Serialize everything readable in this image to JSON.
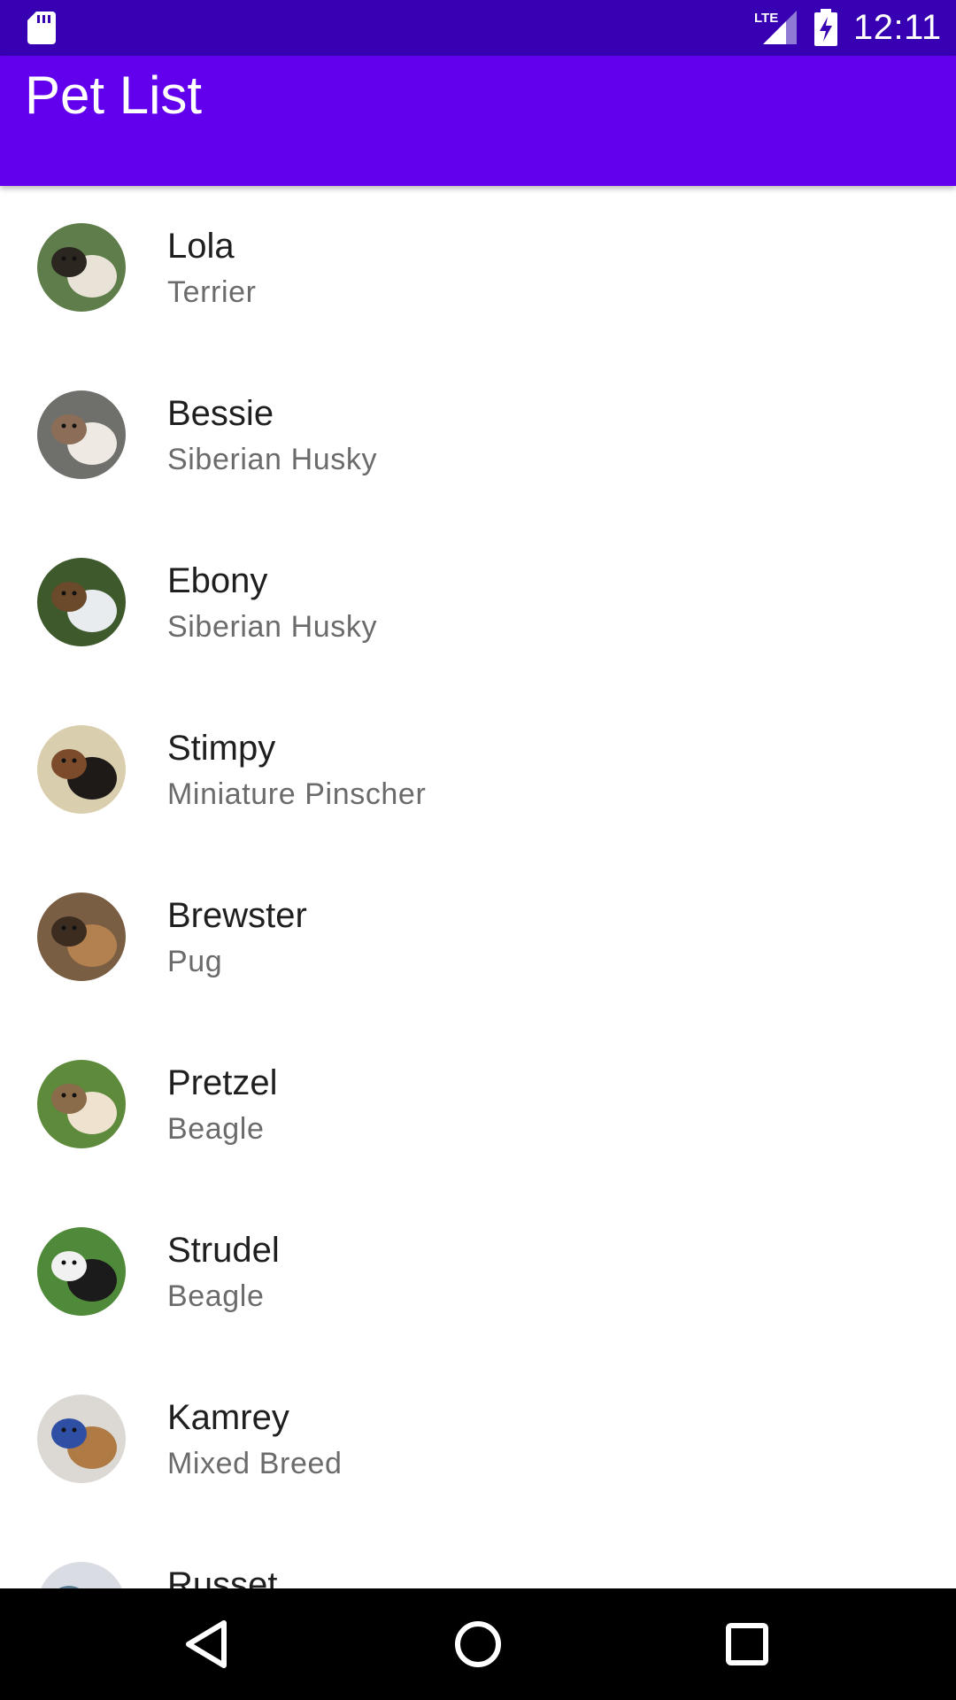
{
  "status_bar": {
    "time": "12:11",
    "network": "LTE",
    "icons": [
      "sd-card-icon",
      "lte-signal-icon",
      "battery-charging-icon"
    ]
  },
  "app_bar": {
    "title": "Pet List",
    "color": "#6200EE",
    "status_color": "#3700B3"
  },
  "pets": [
    {
      "name": "Lola",
      "breed": "Terrier",
      "avatar_colors": [
        "#5f7d4a",
        "#e9e2d6",
        "#2b2620"
      ]
    },
    {
      "name": "Bessie",
      "breed": "Siberian Husky",
      "avatar_colors": [
        "#6f6f6c",
        "#efe9e3",
        "#8c6e58"
      ]
    },
    {
      "name": "Ebony",
      "breed": "Siberian Husky",
      "avatar_colors": [
        "#3e5a2c",
        "#e9ecef",
        "#6a4a2a"
      ]
    },
    {
      "name": "Stimpy",
      "breed": "Miniature Pinscher",
      "avatar_colors": [
        "#d9cfae",
        "#1d1a17",
        "#7b4b2b"
      ]
    },
    {
      "name": "Brewster",
      "breed": "Pug",
      "avatar_colors": [
        "#7a5e44",
        "#b3814f",
        "#3c2c20"
      ]
    },
    {
      "name": "Pretzel",
      "breed": "Beagle",
      "avatar_colors": [
        "#5e8a3b",
        "#efe2cf",
        "#8a6b4a"
      ]
    },
    {
      "name": "Strudel",
      "breed": "Beagle",
      "avatar_colors": [
        "#4f8a3a",
        "#1b1b1b",
        "#f1f1f1"
      ]
    },
    {
      "name": "Kamrey",
      "breed": "Mixed Breed",
      "avatar_colors": [
        "#dcd8d4",
        "#b07a45",
        "#2e4fa3"
      ]
    },
    {
      "name": "Russet",
      "breed": "",
      "avatar_colors": [
        "#d9dde3",
        "#b43a3a",
        "#5b7c93"
      ]
    }
  ]
}
